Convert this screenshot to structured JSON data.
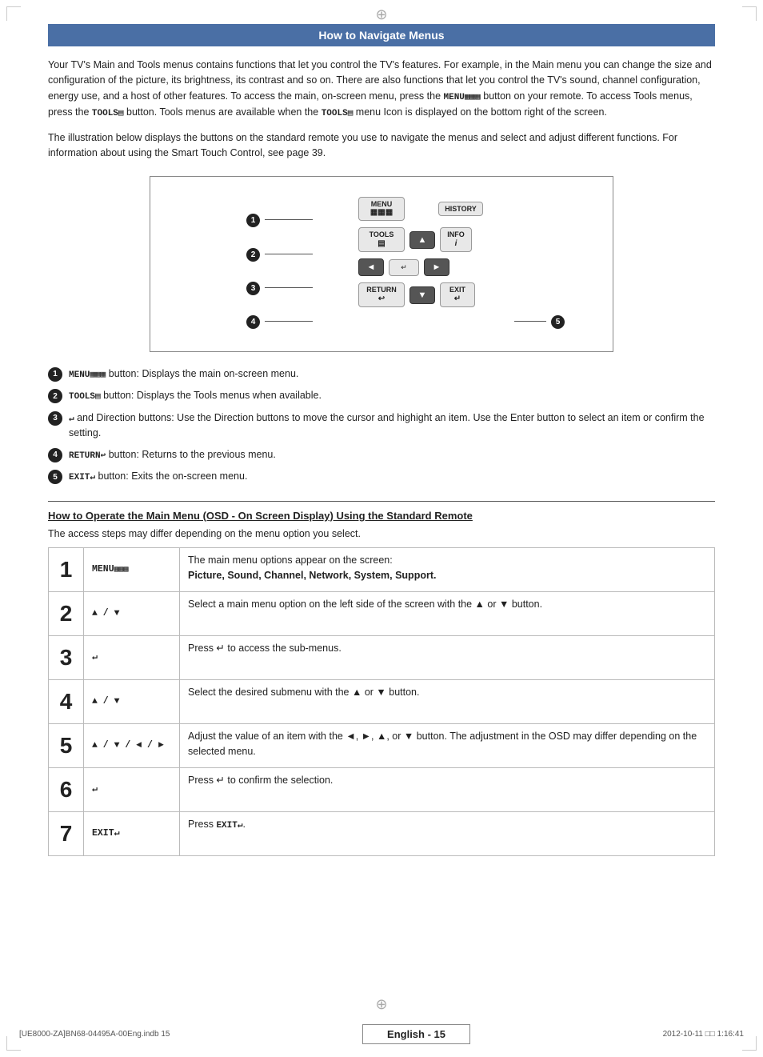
{
  "page": {
    "corner_marks": true,
    "crosshair_top": true,
    "crosshair_bottom": true
  },
  "header": {
    "title": "How to Navigate Menus"
  },
  "intro_paragraph": "Your TV's Main and Tools menus contains functions that let you control the TV's features. For example, in the Main menu you can change the size and configuration of the picture, its brightness, its contrast and so on. There are also functions that let you control the TV's sound, channel configuration, energy use, and a host of other features. To access the main, on-screen menu, press the MENU button on your remote. To access Tools menus, press the TOOLS button. Tools menus are available when the TOOLS menu Icon is displayed on the bottom right of the screen.",
  "illustration_note": "The illustration below displays the buttons on the standard remote you use to navigate the menus and select and adjust different functions. For information about using the Smart Touch Control, see page 39.",
  "callouts": [
    {
      "num": "1",
      "label": "1"
    },
    {
      "num": "2",
      "label": "2"
    },
    {
      "num": "3",
      "label": "3"
    },
    {
      "num": "4",
      "label": "4"
    },
    {
      "num": "5",
      "label": "5"
    }
  ],
  "remote_buttons": {
    "row1": [
      "MENU\n▦▦▦",
      "HISTORY"
    ],
    "row2": [
      "TOOLS\n▤",
      "▲",
      "INFO\nℹ"
    ],
    "row3": [
      "◄",
      "↵",
      "►"
    ],
    "row4": [
      "RETURN\n↩",
      "▼",
      "EXIT\n↵"
    ]
  },
  "descriptions": [
    {
      "num": "1",
      "icon": "MENU▦▦▦",
      "text": "button: Displays the main on-screen menu."
    },
    {
      "num": "2",
      "icon": "TOOLS▤",
      "text": "button: Displays the Tools menus when available."
    },
    {
      "num": "3",
      "icon": "↵",
      "text": "and Direction buttons: Use the Direction buttons to move the cursor and highight an item. Use the Enter button to select an item or confirm the setting."
    },
    {
      "num": "4",
      "icon": "RETURN↩",
      "text": "button: Returns to the previous menu."
    },
    {
      "num": "5",
      "icon": "EXIT↵",
      "text": "button: Exits the on-screen menu."
    }
  ],
  "osd_section": {
    "title": "How to Operate the Main Menu (OSD - On Screen Display) Using the Standard Remote",
    "subtitle": "The access steps may differ depending on the menu option you select.",
    "rows": [
      {
        "num": "1",
        "icon": "MENU▦▦▦",
        "desc_line1": "The main menu options appear on the screen:",
        "desc_line2": "Picture, Sound, Channel, Network, System, Support.",
        "bold_line2": true
      },
      {
        "num": "2",
        "icon": "▲ / ▼",
        "desc_line1": "Select a main menu option on the left side of the screen with the ▲ or ▼ button."
      },
      {
        "num": "3",
        "icon": "↵",
        "desc_line1": "Press ↵ to access the sub-menus."
      },
      {
        "num": "4",
        "icon": "▲ / ▼",
        "desc_line1": "Select the desired submenu with the ▲ or ▼ button."
      },
      {
        "num": "5",
        "icon": "▲ / ▼ / ◄ / ►",
        "desc_line1": "Adjust the value of an item with the ◄, ►, ▲, or ▼ button. The adjustment in the OSD may differ depending on the selected menu."
      },
      {
        "num": "6",
        "icon": "↵",
        "desc_line1": "Press ↵ to confirm the selection."
      },
      {
        "num": "7",
        "icon": "EXIT↵",
        "desc_line1": "Press EXIT↵."
      }
    ]
  },
  "footer": {
    "left_text": "[UE8000-ZA]BN68-04495A-00Eng.indb   15",
    "page_label": "English - 15",
    "right_text": "2012-10-11   □□ 1:16:41"
  }
}
